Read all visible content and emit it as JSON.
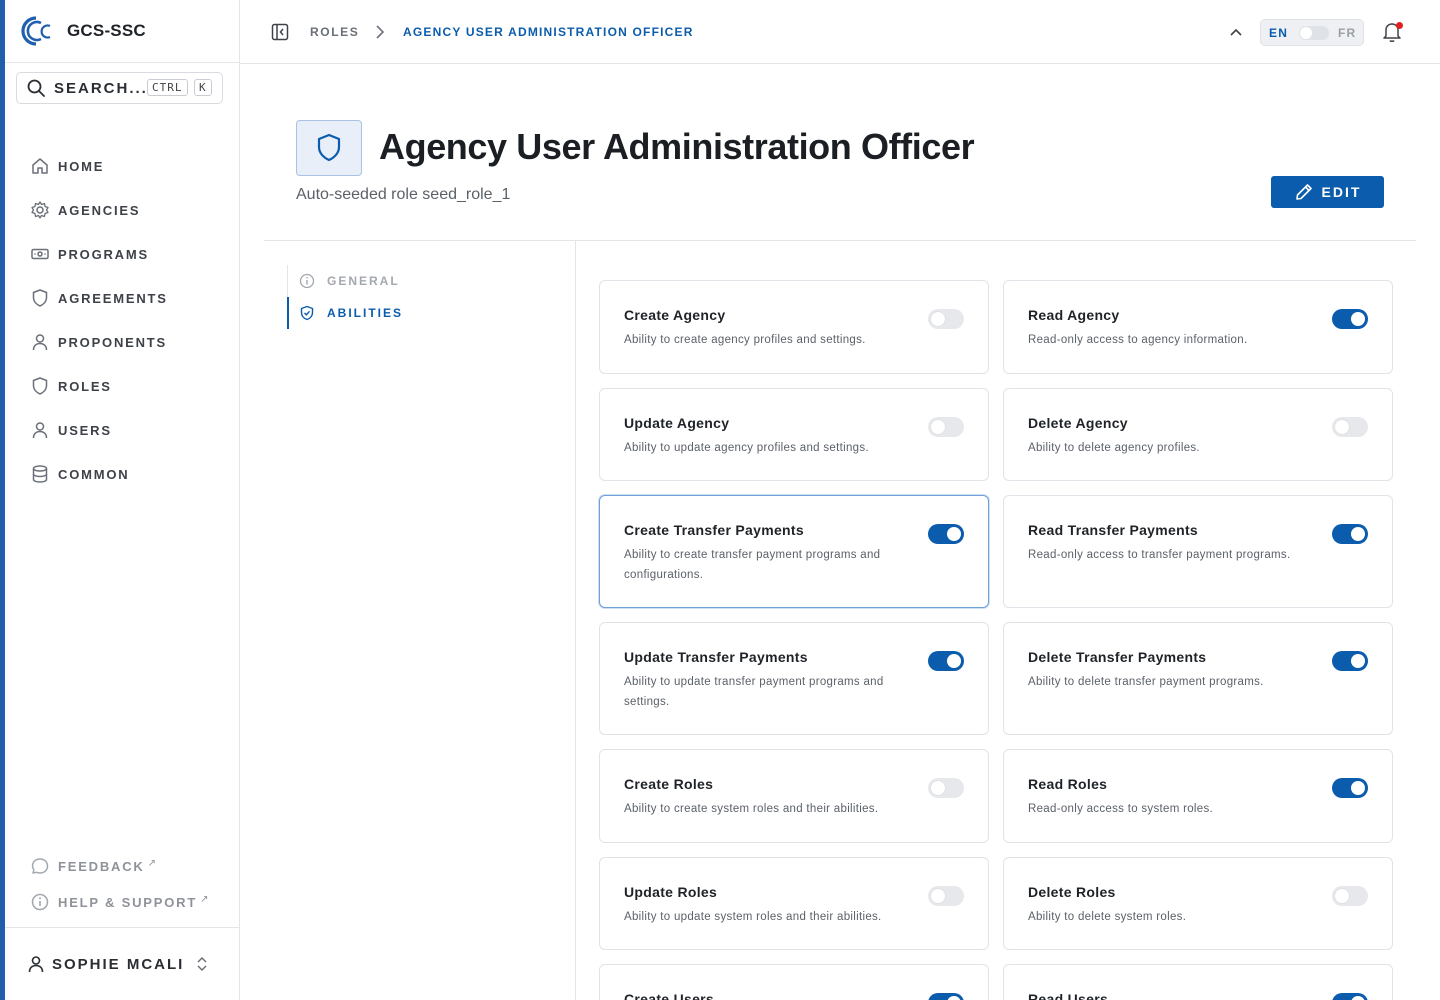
{
  "app": {
    "name": "GCS-SSC"
  },
  "search": {
    "label": "SEARCH...",
    "kbd_ctrl": "CTRL",
    "kbd_k": "K"
  },
  "nav": [
    {
      "label": "HOME",
      "icon": "home-icon"
    },
    {
      "label": "AGENCIES",
      "icon": "gear-icon"
    },
    {
      "label": "PROGRAMS",
      "icon": "banknote-icon"
    },
    {
      "label": "AGREEMENTS",
      "icon": "shield-icon"
    },
    {
      "label": "PROPONENTS",
      "icon": "user-icon"
    },
    {
      "label": "ROLES",
      "icon": "shield-icon"
    },
    {
      "label": "USERS",
      "icon": "user-icon"
    },
    {
      "label": "COMMON",
      "icon": "database-icon"
    }
  ],
  "footer_links": [
    {
      "label": "FEEDBACK",
      "icon": "chat-icon"
    },
    {
      "label": "HELP & SUPPORT",
      "icon": "info-icon"
    }
  ],
  "user": {
    "name": "SOPHIE MCALISTER"
  },
  "breadcrumb": {
    "parent": "ROLES",
    "current": "AGENCY USER ADMINISTRATION OFFICER"
  },
  "language": {
    "en": "EN",
    "fr": "FR",
    "selected": "EN"
  },
  "header": {
    "title": "Agency User Administration Officer",
    "subtitle": "Auto-seeded role seed_role_1",
    "edit_label": "EDIT"
  },
  "sections": [
    {
      "label": "GENERAL",
      "active": false
    },
    {
      "label": "ABILITIES",
      "active": true
    }
  ],
  "abilities": [
    {
      "title": "Create Agency",
      "desc": "Ability to create agency profiles and settings.",
      "enabled": false
    },
    {
      "title": "Read Agency",
      "desc": "Read-only access to agency information.",
      "enabled": true
    },
    {
      "title": "Update Agency",
      "desc": "Ability to update agency profiles and settings.",
      "enabled": false
    },
    {
      "title": "Delete Agency",
      "desc": "Ability to delete agency profiles.",
      "enabled": false
    },
    {
      "title": "Create Transfer Payments",
      "desc": "Ability to create transfer payment programs and configurations.",
      "enabled": true
    },
    {
      "title": "Read Transfer Payments",
      "desc": "Read-only access to transfer payment programs.",
      "enabled": true
    },
    {
      "title": "Update Transfer Payments",
      "desc": "Ability to update transfer payment programs and settings.",
      "enabled": true
    },
    {
      "title": "Delete Transfer Payments",
      "desc": "Ability to delete transfer payment programs.",
      "enabled": true
    },
    {
      "title": "Create Roles",
      "desc": "Ability to create system roles and their abilities.",
      "enabled": false
    },
    {
      "title": "Read Roles",
      "desc": "Read-only access to system roles.",
      "enabled": true
    },
    {
      "title": "Update Roles",
      "desc": "Ability to update system roles and their abilities.",
      "enabled": false
    },
    {
      "title": "Delete Roles",
      "desc": "Ability to delete system roles.",
      "enabled": false
    },
    {
      "title": "Create Users",
      "desc": "",
      "enabled": true
    },
    {
      "title": "Read Users",
      "desc": "",
      "enabled": true
    }
  ],
  "colors": {
    "accent": "#0b5cad",
    "brand_bar": "#1f5fae",
    "notification": "#e02020"
  }
}
